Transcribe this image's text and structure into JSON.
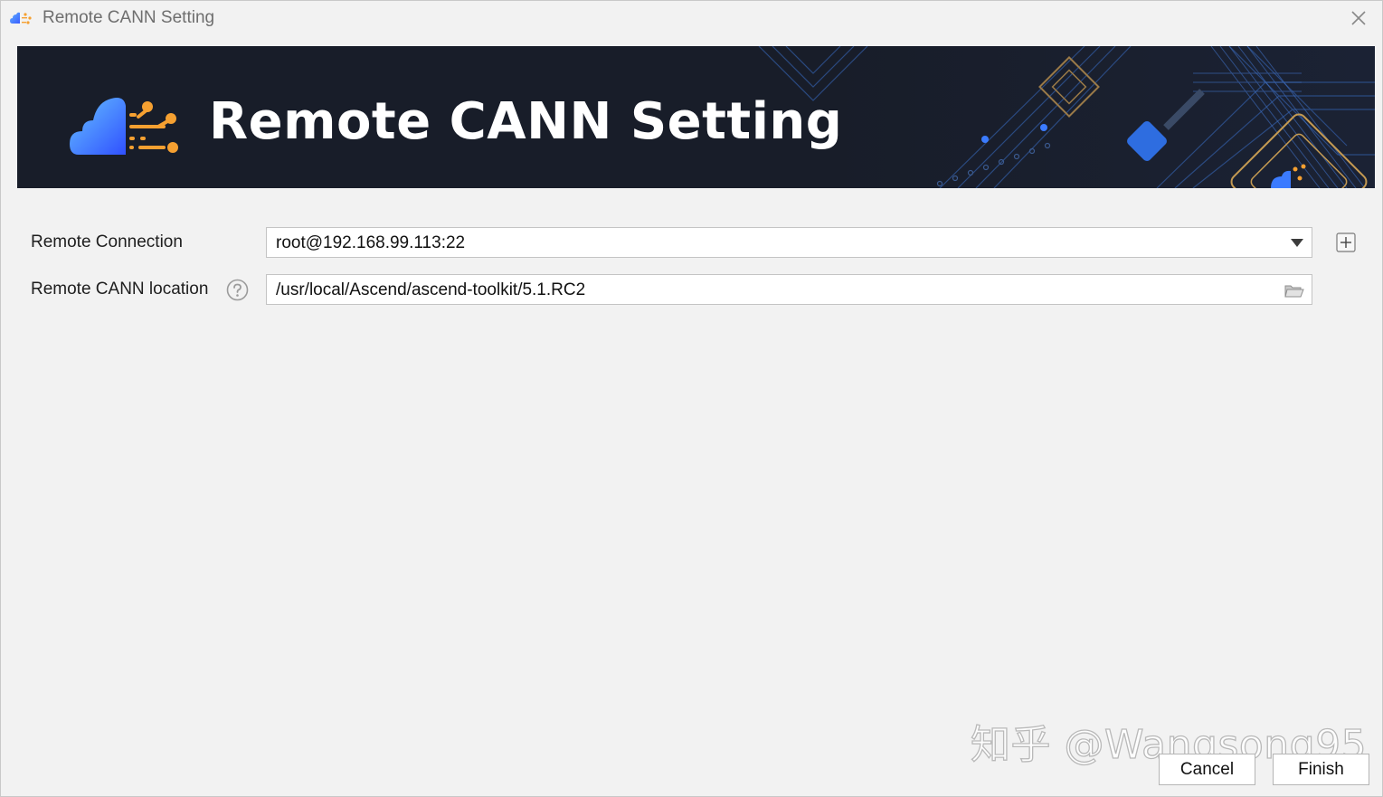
{
  "window": {
    "title": "Remote CANN Setting"
  },
  "banner": {
    "title": "Remote CANN Setting"
  },
  "form": {
    "remote_connection": {
      "label": "Remote Connection",
      "value": "root@192.168.99.113:22"
    },
    "remote_cann_location": {
      "label": "Remote CANN location",
      "value": "/usr/local/Ascend/ascend-toolkit/5.1.RC2"
    }
  },
  "watermark": "知乎 @Wangsong95",
  "buttons": {
    "cancel": "Cancel",
    "finish": "Finish"
  },
  "icons": {
    "app": "cann-cloud-icon",
    "close": "close-icon",
    "dropdown": "chevron-down-icon",
    "add": "plus-box-icon",
    "help": "help-circle-icon",
    "folder": "folder-open-icon"
  },
  "colors": {
    "banner_bg": "#181d29",
    "accent_blue": "#3b7bff",
    "accent_orange": "#f5a031",
    "window_bg": "#f2f2f2"
  }
}
